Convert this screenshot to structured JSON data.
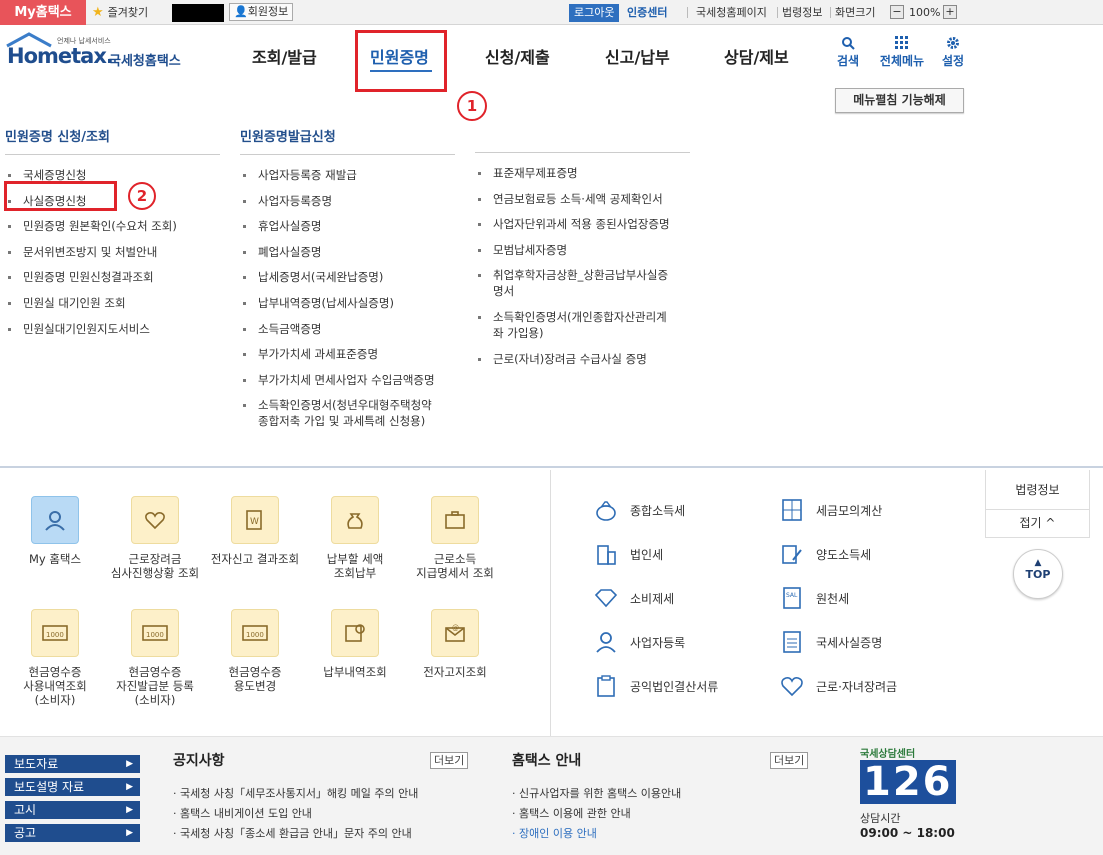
{
  "topbar": {
    "my_hometax": "My홈택스",
    "favorites": "즐겨찾기",
    "member_info": "회원정보",
    "logout": "로그아웃",
    "cert_center": "인증센터",
    "links": [
      "국세청홈페이지",
      "법령정보",
      "화면크기"
    ],
    "zoom": "100%",
    "zoom_minus": "−",
    "zoom_plus": "+"
  },
  "logo": {
    "small": "언제나 납세서비스",
    "main": "Hometax.",
    "org": "국세청홈택스"
  },
  "gnb": [
    "조회/발급",
    "민원증명",
    "신청/제출",
    "신고/납부",
    "상담/제보"
  ],
  "utility": [
    "검색",
    "전체메뉴",
    "설정"
  ],
  "callouts": [
    "1",
    "2"
  ],
  "menu_off_button": "메뉴펼침 기능해제",
  "mega_menu": {
    "col1": {
      "title": "민원증명 신청/조회",
      "items": [
        "국세증명신청",
        "사실증명신청",
        "민원증명 원본확인(수요처 조회)",
        "문서위변조방지 및 처벌안내",
        "민원증명 민원신청결과조회",
        "민원실 대기인원 조회",
        "민원실대기인원지도서비스"
      ]
    },
    "col2": {
      "title": "민원증명발급신청",
      "items": [
        "사업자등록증 재발급",
        "사업자등록증명",
        "휴업사실증명",
        "폐업사실증명",
        "납세증명서(국세완납증명)",
        "납부내역증명(납세사실증명)",
        "소득금액증명",
        "부가가치세 과세표준증명",
        "부가가치세 면세사업자 수입금액증명",
        "소득확인증명서(청년우대형주택청약\n종합저축 가입 및 과세특례 신청용)"
      ]
    },
    "col3": {
      "items": [
        "표준재무제표증명",
        "연금보험료등 소득·세액 공제확인서",
        "사업자단위과세 적용 종된사업장증명",
        "모범납세자증명",
        "취업후학자금상환_상환금납부사실증\n명서",
        "소득확인증명서(개인종합자산관리계\n좌 가입용)",
        "근로(자녀)장려금 수급사실 증명"
      ]
    }
  },
  "services_row1": [
    "My 홈택스",
    "근로장려금\n심사진행상황 조회",
    "전자신고 결과조회",
    "납부할 세액\n조회납부",
    "근로소득\n지급명세서 조회"
  ],
  "services_row2": [
    "현금영수증\n사용내역조회\n(소비자)",
    "현금영수증\n자진발급분 등록\n(소비자)",
    "현금영수증\n용도변경",
    "납부내역조회",
    "전자고지조회"
  ],
  "tax_links_left": [
    "종합소득세",
    "법인세",
    "소비제세",
    "사업자등록",
    "공익법인결산서류"
  ],
  "tax_links_right": [
    "세금모의계산",
    "양도소득세",
    "원천세",
    "국세사실증명",
    "근로·자녀장려금"
  ],
  "side": {
    "law": "법령정보",
    "fold": "접기 ^",
    "top": "TOP"
  },
  "footer": {
    "side_links": [
      "보도자료",
      "보도설명 자료",
      "고시",
      "공고"
    ],
    "notice": {
      "title": "공지사항",
      "more": "더보기",
      "items": [
        "국세청 사칭「세무조사통지서」해킹 메일 주의 안내",
        "홈택스 내비게이션 도입 안내",
        "국세청 사칭「종소세 환급금 안내」문자 주의 안내"
      ]
    },
    "guide": {
      "title": "홈택스 안내",
      "more": "더보기",
      "items": [
        "신규사업자를 위한 홈택스 이용안내",
        "홈택스 이용에 관한 안내",
        "장애인 이용 안내"
      ]
    },
    "center": {
      "label": "국세상담센터",
      "number": "126",
      "hours_label": "상담시간",
      "hours": "09:00 ~ 18:00"
    }
  },
  "colors": {
    "brand_blue": "#1f4d8e",
    "accent_red": "#e0232a",
    "my_red": "#e8545a",
    "link_blue": "#2e6fbf"
  }
}
